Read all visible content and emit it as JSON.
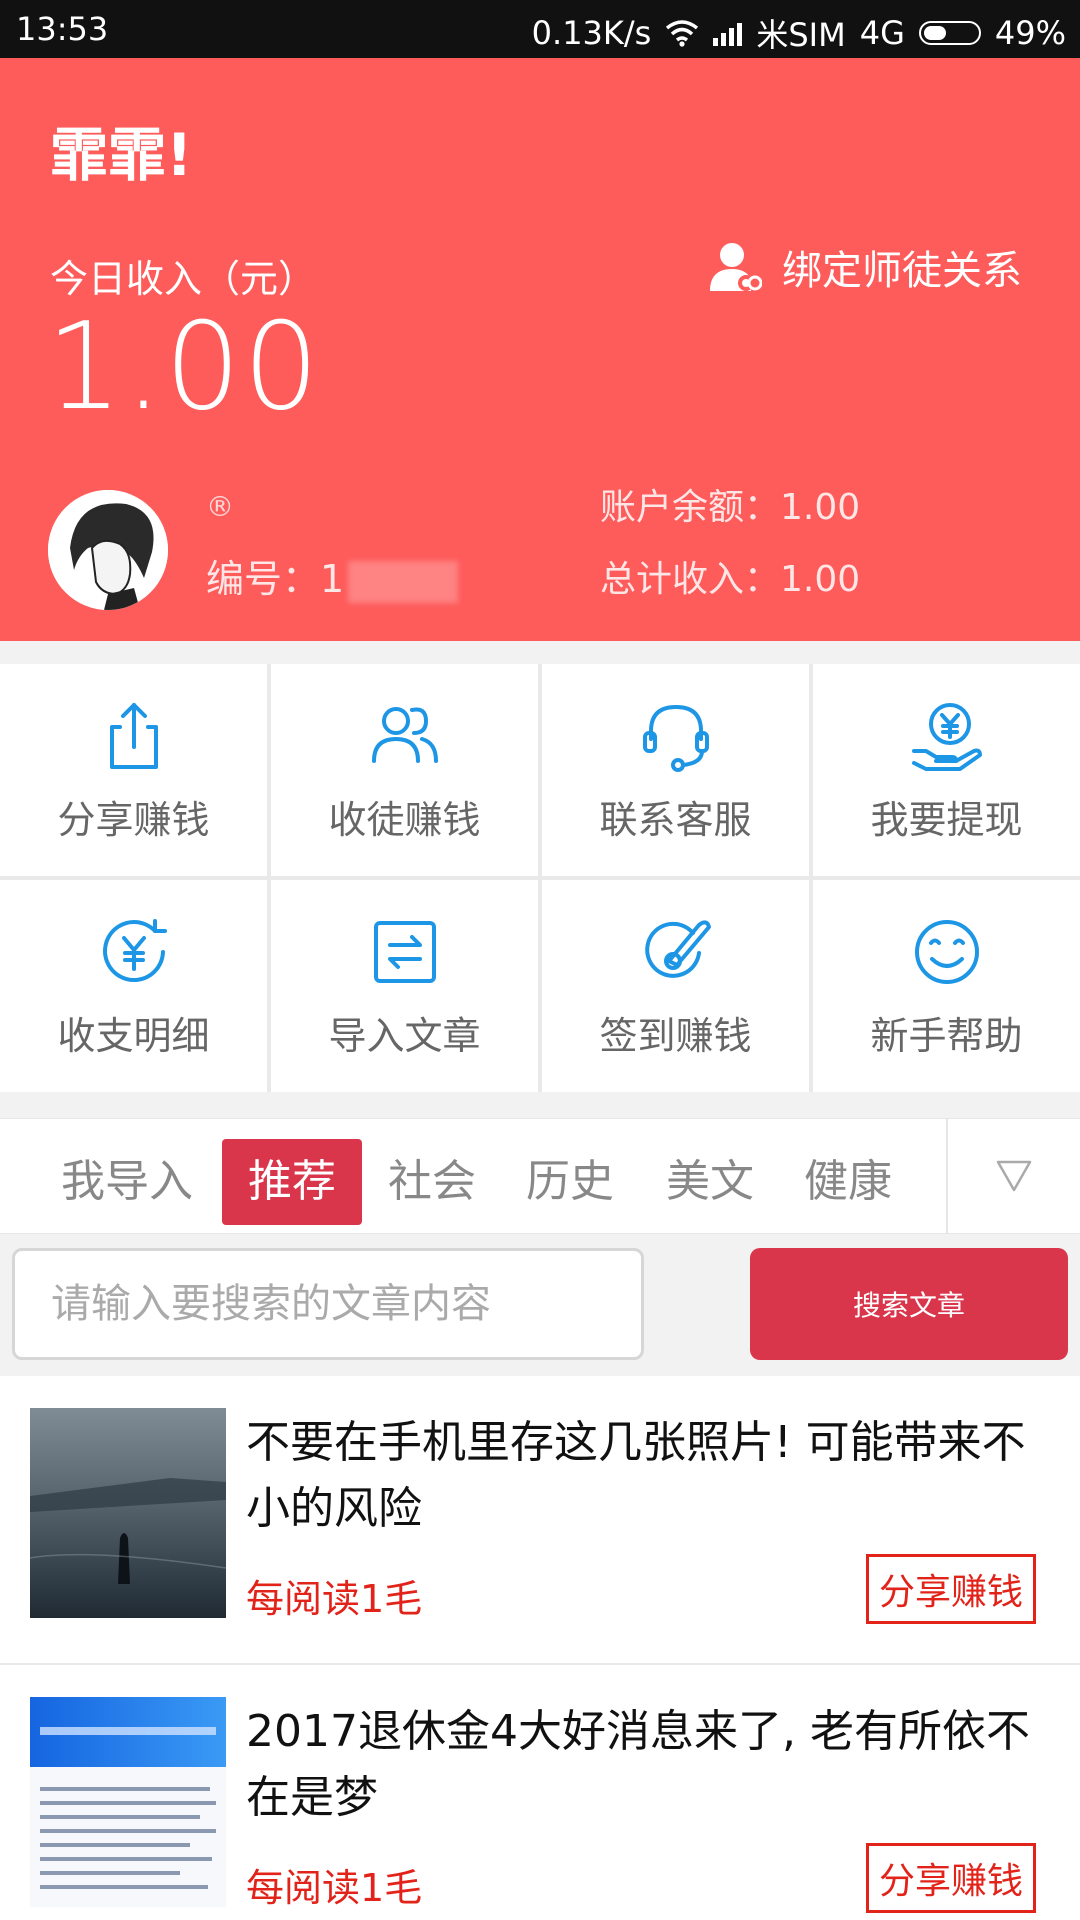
{
  "status_bar": {
    "time": "13:53",
    "speed": "0.13K/s",
    "carrier": "米SIM",
    "network": "4G",
    "battery": "49%",
    "battery_level": 0.49
  },
  "header": {
    "greeting": "霏霏!",
    "income_label": "今日收入（元）",
    "income_value": "1.00",
    "bind_label": "绑定师徒关系",
    "registered_mark": "®",
    "id_label": "编号：",
    "id_value": "1",
    "balance_text": "账户余额：1.00",
    "total_text": "总计收入：1.00"
  },
  "grid": {
    "items": [
      {
        "label": "分享赚钱",
        "icon": "share-icon"
      },
      {
        "label": "收徒赚钱",
        "icon": "users-icon"
      },
      {
        "label": "联系客服",
        "icon": "headset-icon"
      },
      {
        "label": "我要提现",
        "icon": "withdraw-icon"
      },
      {
        "label": "收支明细",
        "icon": "yuan-icon"
      },
      {
        "label": "导入文章",
        "icon": "import-icon"
      },
      {
        "label": "签到赚钱",
        "icon": "checkin-icon"
      },
      {
        "label": "新手帮助",
        "icon": "smile-icon"
      }
    ]
  },
  "tabs": {
    "items": [
      "我导入",
      "推荐",
      "社会",
      "历史",
      "美文",
      "健康"
    ],
    "active": "推荐",
    "more_icon": "dropdown-triangle-icon"
  },
  "search": {
    "placeholder": "请输入要搜索的文章内容",
    "button": "搜索文章"
  },
  "articles": [
    {
      "title": "不要在手机里存这几张照片! 可能带来不小的风险",
      "rate": "每阅读1毛",
      "share": "分享赚钱"
    },
    {
      "title": "2017退休金4大好消息来了, 老有所依不在是梦",
      "rate": "每阅读1毛",
      "share": "分享赚钱"
    }
  ],
  "colors": {
    "header_bg": "#fe5b5b",
    "accent": "#d9364c",
    "icon_blue": "#1e96e6",
    "article_red": "#e2231a"
  }
}
